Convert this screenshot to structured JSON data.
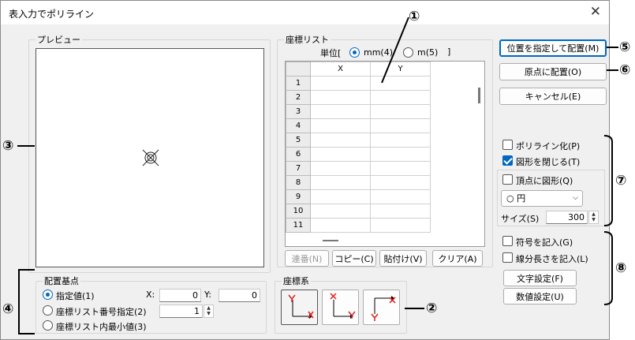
{
  "window": {
    "title": "表入力でポリライン",
    "close_glyph": "✕"
  },
  "preview": {
    "legend": "プレビュー"
  },
  "coordinate_list": {
    "legend": "座標リスト",
    "unit_prefix": "単位[",
    "unit_mm": "mm(4)",
    "unit_m": "m(5)",
    "unit_suffix": "]",
    "selected_unit": "mm",
    "columns": [
      "X",
      "Y"
    ],
    "rows": [
      "1",
      "2",
      "3",
      "4",
      "5",
      "6",
      "7",
      "8",
      "9",
      "10",
      "11"
    ],
    "buttons": {
      "sequence": "連番(N)",
      "copy": "コピー(C)",
      "paste": "貼付け(V)",
      "clear": "クリア(A)"
    }
  },
  "placement_base": {
    "legend": "配置基点",
    "options": [
      "指定値(1)",
      "座標リスト番号指定(2)",
      "座標リスト内最小値(3)"
    ],
    "selected": 0,
    "x_label": "X:",
    "x_value": "0",
    "y_label": "Y:",
    "y_value": "0",
    "list_number": "1"
  },
  "coord_system": {
    "legend": "座標系",
    "options": [
      "coord-system-1",
      "coord-system-2",
      "coord-system-3"
    ],
    "selected": 0
  },
  "actions": {
    "place_at_position": "位置を指定して配置(M)",
    "place_at_origin": "原点に配置(O)",
    "cancel": "キャンセル(E)"
  },
  "polyline_options": {
    "polylinize": {
      "label": "ポリライン化(P)",
      "checked": false
    },
    "close_shape": {
      "label": "図形を閉じる(T)",
      "checked": true
    },
    "vertex_shape": {
      "label": "頂点に図形(Q)",
      "checked": false
    },
    "shape_select": "○ 円",
    "size_label": "サイズ(S)",
    "size_value": "300"
  },
  "text_options": {
    "write_symbol": {
      "label": "符号を記入(G)",
      "checked": false
    },
    "write_length": {
      "label": "線分長さを記入(L)",
      "checked": false
    },
    "text_settings": "文字設定(F)",
    "number_settings": "数値設定(U)"
  },
  "callouts": [
    "①",
    "②",
    "③",
    "④",
    "⑤",
    "⑥",
    "⑦",
    "⑧"
  ],
  "colors": {
    "accent": "#0067c0",
    "callout_line": "#000000",
    "marker_red": "#e02020"
  }
}
